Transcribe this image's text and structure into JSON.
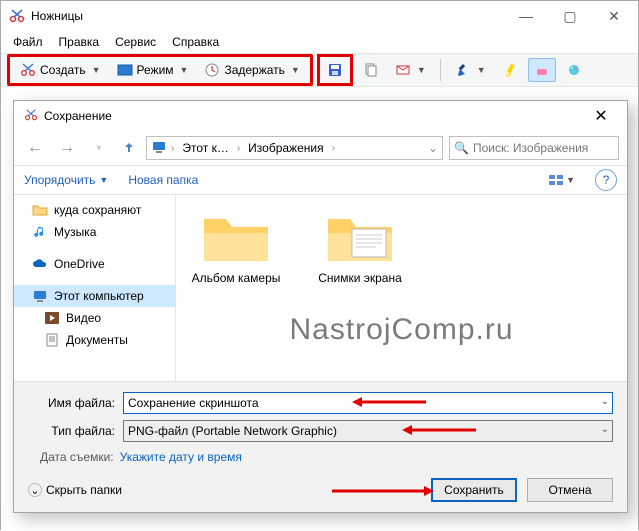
{
  "app": {
    "title": "Ножницы",
    "menu": {
      "file": "Файл",
      "edit": "Правка",
      "tools": "Сервис",
      "help": "Справка"
    },
    "toolbar": {
      "create": "Создать",
      "mode": "Режим",
      "delay": "Задержать"
    }
  },
  "dialog": {
    "title": "Сохранение",
    "nav_back": "←",
    "nav_fwd": "→",
    "nav_up": "↑",
    "breadcrumb": {
      "root": "Этот к…",
      "folder": "Изображения"
    },
    "search_placeholder": "Поиск: Изображения",
    "organize": "Упорядочить",
    "new_folder": "Новая папка",
    "tree": {
      "downloads": "куда сохраняют",
      "music": "Музыка",
      "onedrive": "OneDrive",
      "this_pc": "Этот компьютер",
      "videos": "Видео",
      "documents": "Документы"
    },
    "content": {
      "folder1": "Альбом камеры",
      "folder2": "Снимки экрана"
    },
    "filename_label": "Имя файла:",
    "filename_value": "Сохранение скриншота",
    "filetype_label": "Тип файла:",
    "filetype_value": "PNG-файл (Portable Network Graphic)",
    "date_label": "Дата съемки:",
    "date_link": "Укажите дату и время",
    "hide_folders": "Скрыть папки",
    "save": "Сохранить",
    "cancel": "Отмена"
  },
  "watermark": "NastrojComp.ru"
}
